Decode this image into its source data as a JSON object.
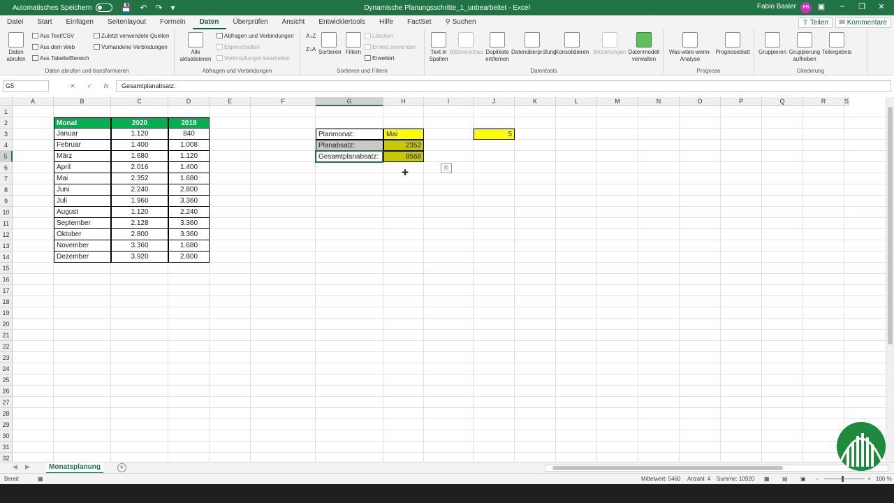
{
  "titlebar": {
    "autosave_label": "Automatisches Speichern",
    "doc_title": "Dynamische Planungsschritte_1_unbearbeitet  -  Excel",
    "user_name": "Fabio Basler",
    "user_initials": "FB"
  },
  "menu": {
    "items": [
      "Datei",
      "Start",
      "Einfügen",
      "Seitenlayout",
      "Formeln",
      "Daten",
      "Überprüfen",
      "Ansicht",
      "Entwicklertools",
      "Hilfe",
      "FactSet",
      "Suchen"
    ],
    "active": "Daten",
    "share_label": "Teilen",
    "comments_label": "Kommentare"
  },
  "ribbon": {
    "groups": {
      "get_data": "Daten abrufen und transformieren",
      "queries": "Abfragen und Verbindungen",
      "sort_filter": "Sortieren und Filtern",
      "data_tools": "Datentools",
      "forecast": "Prognose",
      "outline": "Gliederung"
    },
    "buttons": {
      "get_data_1": "Daten",
      "get_data_2": "abrufen",
      "from_text": "Aus Text/CSV",
      "from_web": "Aus dem Web",
      "from_table": "Aus Tabelle/Bereich",
      "recent_sources": "Zuletzt verwendete Quellen",
      "existing_connections": "Vorhandene Verbindungen",
      "refresh_1": "Alle",
      "refresh_2": "aktualisieren",
      "queries_connections": "Abfragen und Verbindungen",
      "properties": "Eigenschaften",
      "edit_links": "Verknüpfungen bearbeiten",
      "sort": "Sortieren",
      "filter": "Filtern",
      "clear": "Löschen",
      "reapply": "Erneut anwenden",
      "advanced": "Erweitert",
      "text_to_columns_1": "Text in",
      "text_to_columns_2": "Spalten",
      "flash_fill": "Blitzvorschau",
      "remove_duplicates_1": "Duplikate",
      "remove_duplicates_2": "entfernen",
      "data_validation": "Datenüberprüfung",
      "consolidate": "Konsolidieren",
      "relationships": "Beziehungen",
      "data_model_1": "Datenmodell",
      "data_model_2": "verwalten",
      "what_if_1": "Was-wäre-wenn-",
      "what_if_2": "Analyse",
      "forecast_sheet": "Prognoseblatt",
      "group": "Gruppieren",
      "ungroup_1": "Gruppierung",
      "ungroup_2": "aufheben",
      "subtotal": "Teilergebnis"
    }
  },
  "formula_bar": {
    "name_box": "G5",
    "cancel": "✕",
    "enter": "✓",
    "fx": "fx",
    "content": "Gesamtplanabsatz:"
  },
  "columns": [
    "A",
    "B",
    "C",
    "D",
    "E",
    "F",
    "G",
    "H",
    "I",
    "J",
    "K",
    "L",
    "M",
    "N",
    "O",
    "P",
    "Q",
    "R",
    "S"
  ],
  "rows": [
    "1",
    "2",
    "3",
    "4",
    "5",
    "6",
    "7",
    "8",
    "9",
    "10",
    "11",
    "12",
    "13",
    "14",
    "15",
    "16",
    "17",
    "18",
    "19",
    "20",
    "21",
    "22",
    "23",
    "24",
    "25",
    "26",
    "27",
    "28",
    "29",
    "30",
    "31",
    "32"
  ],
  "table": {
    "headers": [
      "Monat",
      "2020",
      "2019"
    ],
    "rows": [
      [
        "Januar",
        "1.120",
        "840"
      ],
      [
        "Februar",
        "1.400",
        "1.008"
      ],
      [
        "März",
        "1.680",
        "1.120"
      ],
      [
        "April",
        "2.016",
        "1.400"
      ],
      [
        "Mai",
        "2.352",
        "1.680"
      ],
      [
        "Juni",
        "2.240",
        "2.800"
      ],
      [
        "Juli",
        "1.960",
        "3.360"
      ],
      [
        "August",
        "1.120",
        "2.240"
      ],
      [
        "September",
        "2.128",
        "3.360"
      ],
      [
        "Oktober",
        "2.800",
        "3.360"
      ],
      [
        "November",
        "3.360",
        "1.680"
      ],
      [
        "Dezember",
        "3.920",
        "2.800"
      ]
    ]
  },
  "plan": {
    "month_label": "Planmonat:",
    "month_value": "Mai",
    "sales_label": "Planabsatz:",
    "sales_value": "2352",
    "total_label": "Gesamtplanabsatz:",
    "total_value": "8568",
    "j3_value": "5"
  },
  "sheet_tab": "Monatsplanung",
  "status": {
    "ready": "Bereit",
    "average": "Mittelwert: 5460",
    "count": "Anzahl: 4",
    "sum": "Summe: 10920",
    "zoom": "100 %"
  },
  "colors": {
    "excel_green": "#217346",
    "header_green": "#00b050",
    "yellow": "#ffff00",
    "olive": "#c8c800"
  }
}
